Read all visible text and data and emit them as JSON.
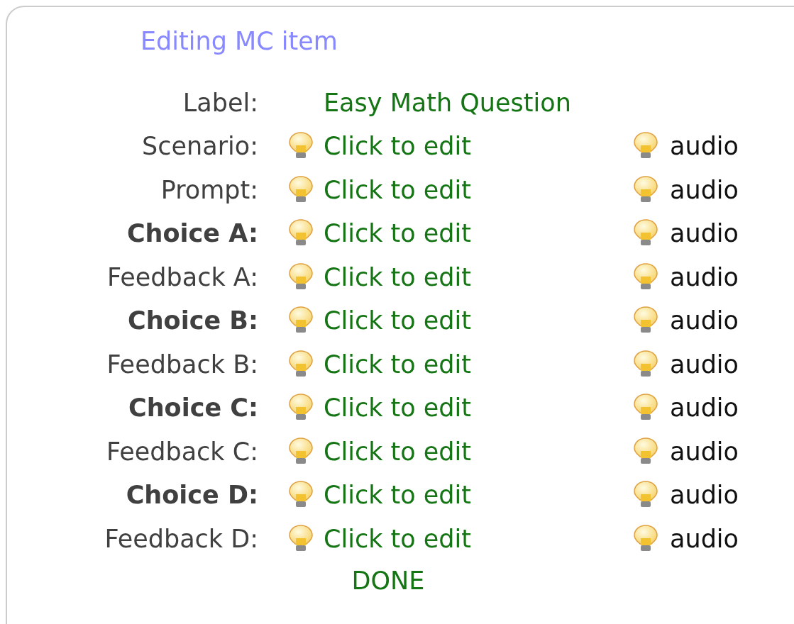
{
  "title": "Editing MC item",
  "rows": [
    {
      "kind": "text",
      "label": "Label:",
      "bold": false,
      "value": "Easy Math Question"
    },
    {
      "kind": "editable",
      "label": "Scenario:",
      "bold": false,
      "value": "Click to edit",
      "audio": "audio"
    },
    {
      "kind": "editable",
      "label": "Prompt:",
      "bold": false,
      "value": "Click to edit",
      "audio": "audio"
    },
    {
      "kind": "editable",
      "label": "Choice A:",
      "bold": true,
      "value": "Click to edit",
      "audio": "audio"
    },
    {
      "kind": "editable",
      "label": "Feedback A:",
      "bold": false,
      "value": "Click to edit",
      "audio": "audio"
    },
    {
      "kind": "editable",
      "label": "Choice B:",
      "bold": true,
      "value": "Click to edit",
      "audio": "audio"
    },
    {
      "kind": "editable",
      "label": "Feedback B:",
      "bold": false,
      "value": "Click to edit",
      "audio": "audio"
    },
    {
      "kind": "editable",
      "label": "Choice C:",
      "bold": true,
      "value": "Click to edit",
      "audio": "audio"
    },
    {
      "kind": "editable",
      "label": "Feedback C:",
      "bold": false,
      "value": "Click to edit",
      "audio": "audio"
    },
    {
      "kind": "editable",
      "label": "Choice D:",
      "bold": true,
      "value": "Click to edit",
      "audio": "audio"
    },
    {
      "kind": "editable",
      "label": "Feedback D:",
      "bold": false,
      "value": "Click to edit",
      "audio": "audio"
    }
  ],
  "done_button": "DONE"
}
